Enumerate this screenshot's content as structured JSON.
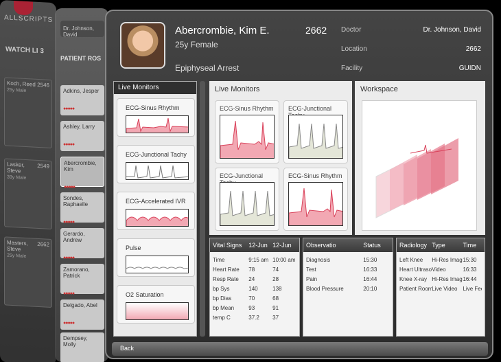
{
  "brand": "ALLSCRIPTS",
  "watch_list": {
    "title": "WATCH LI 3",
    "cards": [
      {
        "name": "Koch, Reed",
        "id": "2546",
        "sub": "25y Male"
      },
      {
        "name": "Lasker, Steve",
        "id": "2549",
        "sub": "39y Male"
      },
      {
        "name": "Masters, Steve",
        "id": "2662",
        "sub": "25y Male"
      }
    ]
  },
  "patient_roster": {
    "title": "PATIENT ROS",
    "doctor": "Dr. Johnson, David",
    "cards": [
      {
        "name": "Adkins, Jesper"
      },
      {
        "name": "Ashley, Larry"
      },
      {
        "name": "Abercrombie, Kim"
      },
      {
        "name": "Sondes, Raphaelle"
      },
      {
        "name": "Gerardo, Andrew"
      },
      {
        "name": "Zamorano, Patrick"
      },
      {
        "name": "Delgado, Abel"
      },
      {
        "name": "Dempsey, Molly"
      }
    ]
  },
  "patient": {
    "name": "Abercrombie, Kim E.",
    "id": "2662",
    "age_sex": "25y Female",
    "diagnosis": "Epiphyseal Arrest"
  },
  "info": [
    {
      "label": "Doctor",
      "value": "Dr. Johnson, David"
    },
    {
      "label": "Location",
      "value": "2662"
    },
    {
      "label": "Facility",
      "value": "GUIDN"
    }
  ],
  "live_monitor_list": {
    "title": "Live Monitors",
    "items": [
      "ECG-Sinus Rhythm",
      "ECG-Junctional Tachy",
      "ECG-Accelerated IVR",
      "Pulse",
      "O2 Saturation"
    ]
  },
  "live_monitors": {
    "title": "Live Monitors",
    "cards": [
      "ECG-Sinus Rhythm",
      "ECG-Junctional Tachy",
      "ECG-Junctional Tachy",
      "ECG-Sinus Rhythm"
    ]
  },
  "workspace": {
    "title": "Workspace"
  },
  "vital_signs": {
    "headers": [
      "Vital Signs",
      "12-Jun",
      "12-Jun"
    ],
    "rows": [
      [
        "Time",
        "9:15 am",
        "10:00 am"
      ],
      [
        "Heart Rate",
        "78",
        "74"
      ],
      [
        "Resp Rate",
        "24",
        "28"
      ],
      [
        "bp Sys",
        "140",
        "138"
      ],
      [
        "bp Dias",
        "70",
        "68"
      ],
      [
        "bp Mean",
        "93",
        "91"
      ],
      [
        "temp C",
        "37.2",
        "37"
      ]
    ]
  },
  "observations": {
    "headers": [
      "Observatio",
      "Status"
    ],
    "rows": [
      [
        "Diagnosis",
        "15:30"
      ],
      [
        "Test",
        "16:33"
      ],
      [
        "Pain",
        "16:44"
      ],
      [
        "Blood Pressure",
        "20:10"
      ]
    ]
  },
  "radiology": {
    "headers": [
      "Radiology",
      "Type",
      "Time"
    ],
    "rows": [
      [
        "Left Knee",
        "Hi-Res Image",
        "15:30"
      ],
      [
        "Heart Ultrasou",
        "Video",
        "16:33"
      ],
      [
        "Knee X-ray",
        "Hi-Res Image",
        "16:44"
      ],
      [
        "Patient Room",
        "Live Video",
        "Live Feed"
      ]
    ]
  },
  "back_label": "Back",
  "colors": {
    "accent_red": "#d9415a",
    "panel_dark": "#2f2f2f"
  }
}
